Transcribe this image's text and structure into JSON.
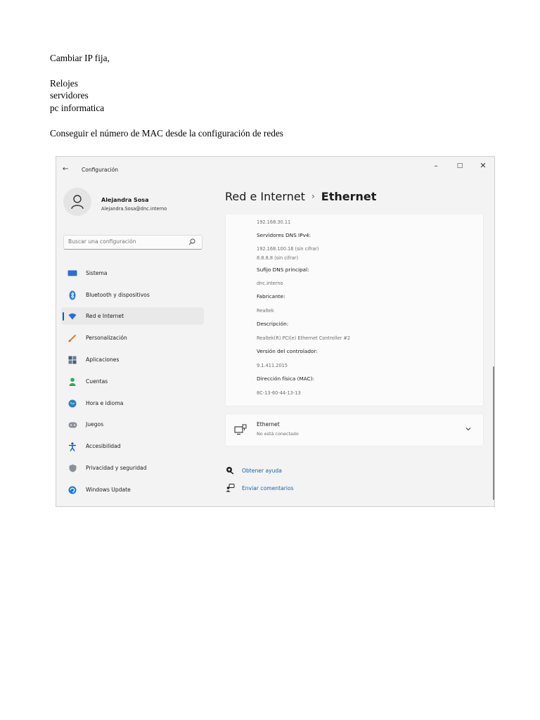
{
  "document": {
    "lines": [
      "Cambiar IP fija,",
      "Relojes",
      "servidores",
      "pc informatica",
      "Conseguir el número de MAC desde la configuración de redes"
    ]
  },
  "settings_window": {
    "title": "Configuración",
    "controls": {
      "minimize": "–",
      "maximize": "□",
      "close": "✕"
    },
    "user": {
      "name": "Alejandra Sosa",
      "email": "Alejandra.Sosa@dnc.interno"
    },
    "search": {
      "placeholder": "Buscar una configuración"
    },
    "nav": [
      {
        "label": "Sistema",
        "icon": "system-icon",
        "color": "#2b6fd1"
      },
      {
        "label": "Bluetooth y dispositivos",
        "icon": "bluetooth-icon",
        "color": "#1f7ae0"
      },
      {
        "label": "Red e Internet",
        "icon": "wifi-icon",
        "color": "#2b6fd1",
        "selected": true
      },
      {
        "label": "Personalización",
        "icon": "brush-icon",
        "color": "#d8822e"
      },
      {
        "label": "Aplicaciones",
        "icon": "apps-icon",
        "color": "#4a5a78"
      },
      {
        "label": "Cuentas",
        "icon": "account-icon",
        "color": "#2faa5b"
      },
      {
        "label": "Hora e idioma",
        "icon": "globe-clock-icon",
        "color": "#2a7fd0"
      },
      {
        "label": "Juegos",
        "icon": "gamepad-icon",
        "color": "#8a8f98"
      },
      {
        "label": "Accesibilidad",
        "icon": "accessibility-icon",
        "color": "#1f5fbf"
      },
      {
        "label": "Privacidad y seguridad",
        "icon": "shield-icon",
        "color": "#8a8f98"
      },
      {
        "label": "Windows Update",
        "icon": "update-icon",
        "color": "#1f7ae0"
      }
    ],
    "breadcrumb": {
      "parent": "Red e Internet",
      "separator": "›",
      "current": "Ethernet"
    },
    "properties": {
      "ipv4_value": "192.168.30.11",
      "dns_label": "Servidores DNS IPv4:",
      "dns_value_1": "192.168.100.16 (sin cifrar)",
      "dns_value_2": "8.8.8.8 (sin cifrar)",
      "suffix_label": "Sufijo DNS principal:",
      "suffix_value": "dnc.interno",
      "manufacturer_label": "Fabricante:",
      "manufacturer_value": "Realtek",
      "description_label": "Descripción:",
      "description_value": "Realtek(R) PCI(e) Ethernet Controller #2",
      "driver_label": "Versión del controlador:",
      "driver_value": "9.1.411.2015",
      "mac_label": "Dirección física (MAC):",
      "mac_value": "8C-13-60-44-13-13"
    },
    "ethernet": {
      "title": "Ethernet",
      "status": "No está conectado"
    },
    "links": {
      "help": "Obtener ayuda",
      "feedback": "Enviar comentarios"
    },
    "accent": "#005fb8"
  }
}
